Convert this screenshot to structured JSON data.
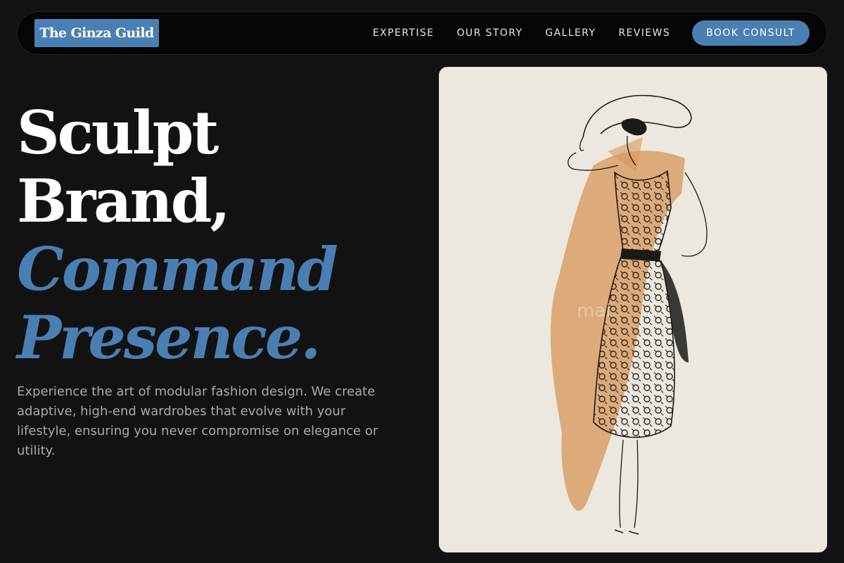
{
  "brand": {
    "logo_text": "The Ginza Guild"
  },
  "nav": {
    "links": [
      "EXPERTISE",
      "OUR STORY",
      "GALLERY",
      "REVIEWS"
    ],
    "cta_label": "BOOK CONSULT"
  },
  "hero": {
    "headline_line1": "Sculpt",
    "headline_line2": "Brand,",
    "headline_line3": "Command",
    "headline_line4": "Presence.",
    "description": "Experience the art of modular fashion design. We create adaptive, high-end wardrobes that evolve with your lifestyle, ensuring you never compromise on elegance or utility."
  },
  "illustration": {
    "subject": "fashion-sketch-woman-in-patterned-dress-with-wide-hat",
    "watermark": "mai"
  },
  "colors": {
    "background": "#121213",
    "accent": "#4a7fb3",
    "nav_bg": "#050506",
    "body_text": "#a7a9ad",
    "paper": "#ece8df",
    "wash": "#d9985c"
  }
}
